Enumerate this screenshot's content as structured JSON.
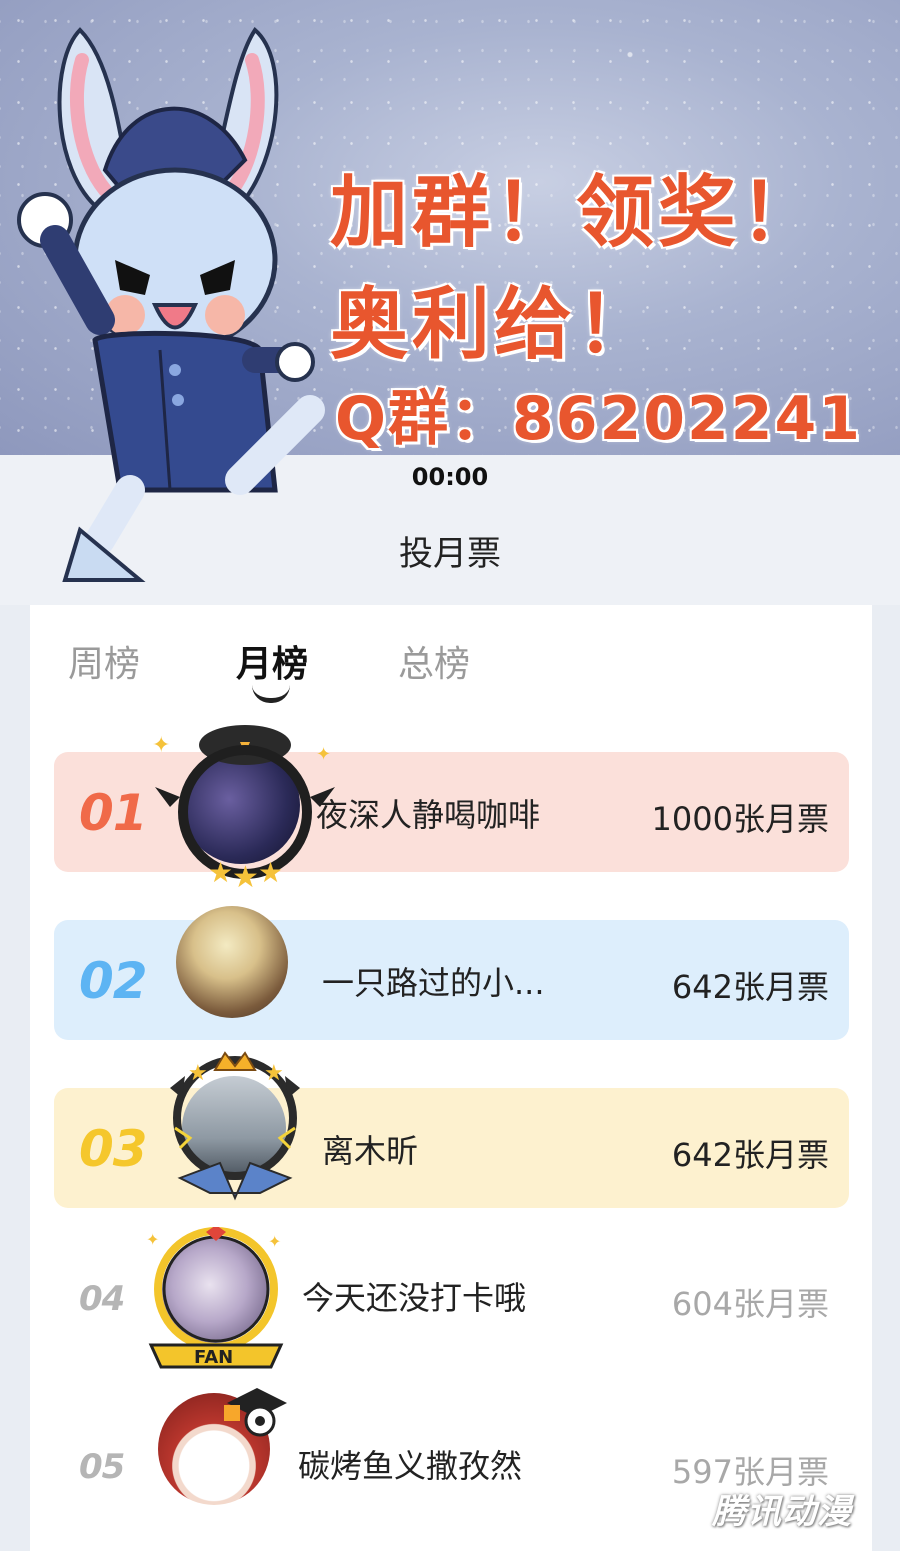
{
  "banner": {
    "line1": "加群！领奖！",
    "line2": "奥利给！",
    "line3": "Q群：86202241",
    "mascot": "bunny-mascot"
  },
  "status": {
    "time": "00:00"
  },
  "page_title": "投月票",
  "tabs": [
    {
      "label": "周榜",
      "active": false
    },
    {
      "label": "月榜",
      "active": true
    },
    {
      "label": "总榜",
      "active": false
    }
  ],
  "ranking": [
    {
      "rank": "01",
      "name": "夜深人静喝咖啡",
      "votes": "1000张月票"
    },
    {
      "rank": "02",
      "name": "一只路过的小...",
      "votes": "642张月票"
    },
    {
      "rank": "03",
      "name": "离木昕",
      "votes": "642张月票"
    },
    {
      "rank": "04",
      "name": "今天还没打卡哦",
      "votes": "604张月票"
    },
    {
      "rank": "05",
      "name": "碳烤鱼义撒孜然",
      "votes": "597张月票"
    }
  ],
  "watermark": "腾讯动漫",
  "colors": {
    "rank1": "#f06a49",
    "rank1_bg": "#fbe0da",
    "rank2": "#5db4f3",
    "rank2_bg": "#ddeefc",
    "rank3": "#f5c72c",
    "rank3_bg": "#fdf1cf",
    "promo": "#e8562e"
  }
}
